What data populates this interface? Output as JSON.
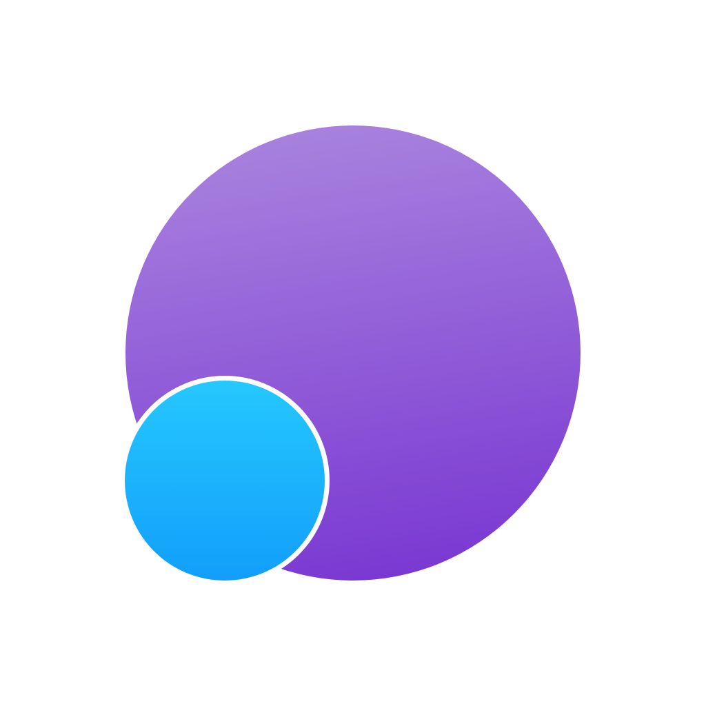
{
  "icon": {
    "name": "two-overlapping-circles-logo",
    "background_color": "#ffffff",
    "large_circle": {
      "gradient_top": "#A882DE",
      "gradient_bottom": "#7A38D2"
    },
    "small_circle": {
      "gradient_top": "#25C8FF",
      "gradient_bottom": "#129EFA",
      "gap_color": "#ffffff"
    }
  }
}
